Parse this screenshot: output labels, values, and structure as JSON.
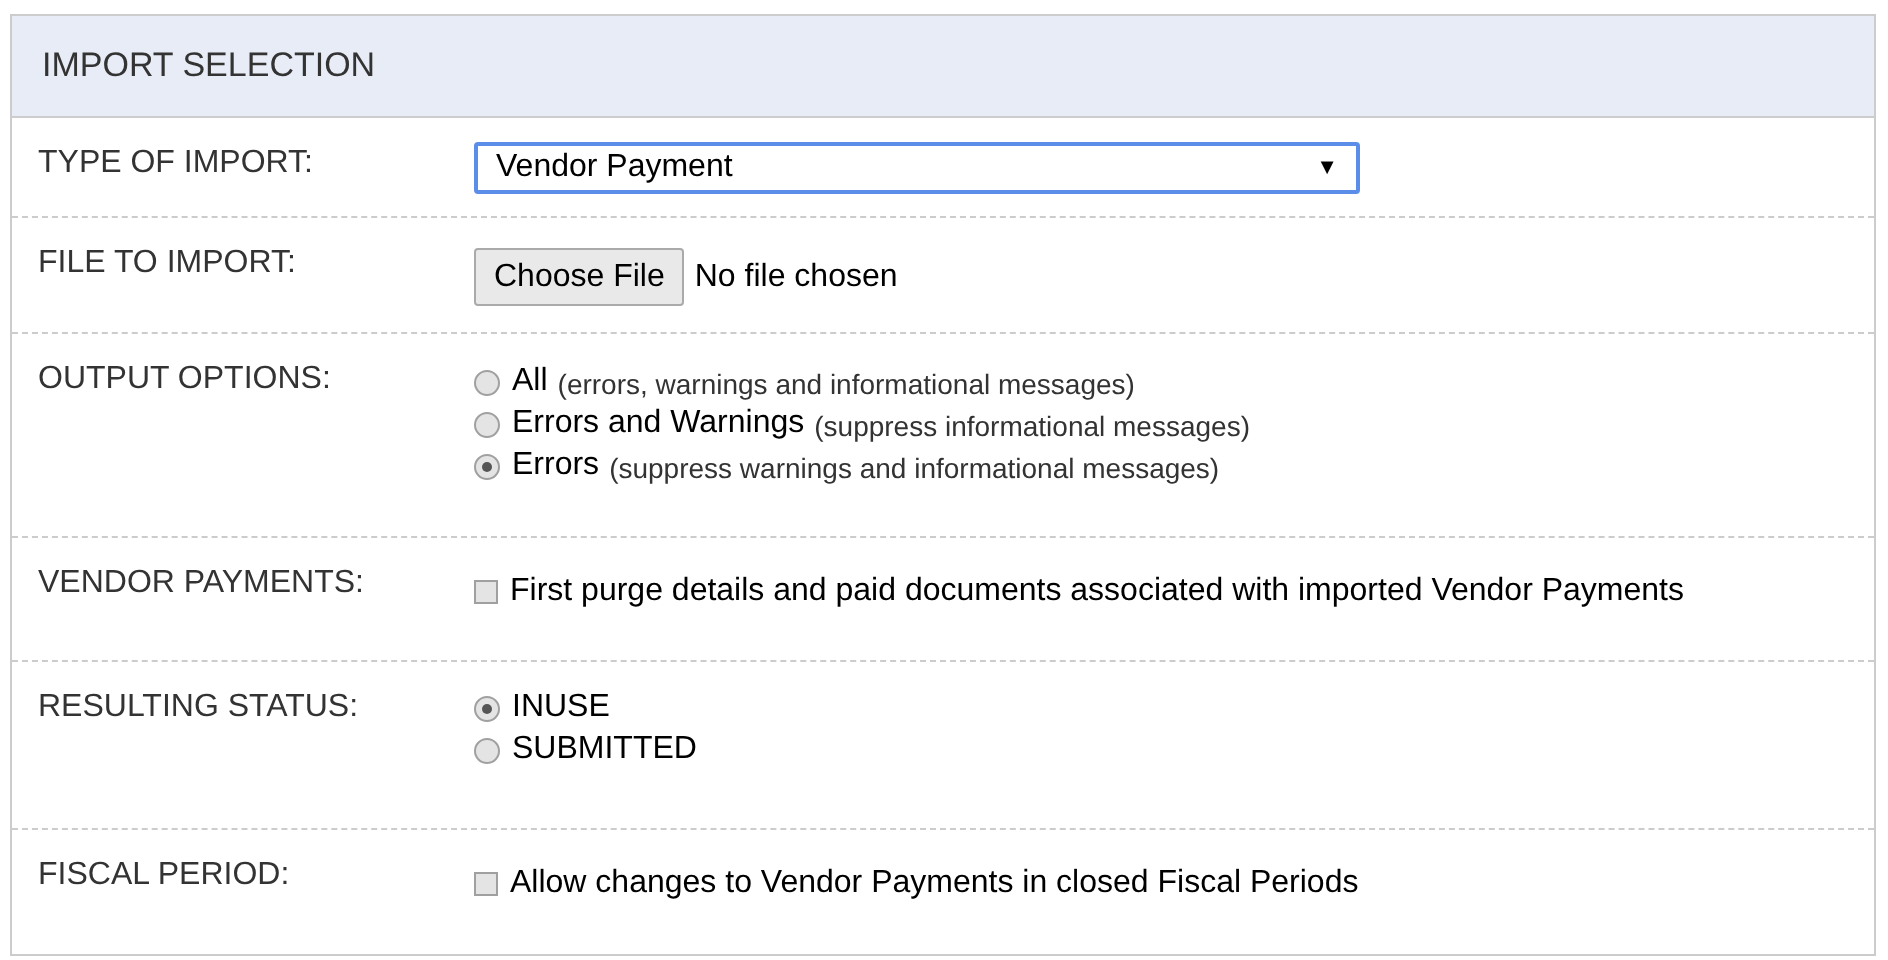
{
  "panel": {
    "title": "IMPORT SELECTION"
  },
  "rows": [
    {
      "kind": "select",
      "label": "TYPE OF IMPORT:",
      "value": "Vendor Payment",
      "arrow": "▼"
    },
    {
      "kind": "file",
      "label": "FILE TO IMPORT:",
      "button": "Choose File",
      "status": "No file chosen"
    },
    {
      "kind": "radio",
      "label": "OUTPUT OPTIONS:",
      "options": [
        {
          "label": "All",
          "note": "(errors, warnings and informational messages)",
          "selected": false
        },
        {
          "label": "Errors and Warnings",
          "note": "(suppress informational messages)",
          "selected": false
        },
        {
          "label": "Errors",
          "note": "(suppress warnings and informational messages)",
          "selected": true
        }
      ]
    },
    {
      "kind": "checkbox",
      "label": "VENDOR PAYMENTS:",
      "text": "First purge details and paid documents associated with imported Vendor Payments",
      "checked": false
    },
    {
      "kind": "radio",
      "label": "RESULTING STATUS:",
      "options": [
        {
          "label": "INUSE",
          "selected": true
        },
        {
          "label": "SUBMITTED",
          "selected": false
        }
      ]
    },
    {
      "kind": "checkbox",
      "label": "FISCAL PERIOD:",
      "text": "Allow changes to Vendor Payments in closed Fiscal Periods",
      "checked": false
    }
  ]
}
